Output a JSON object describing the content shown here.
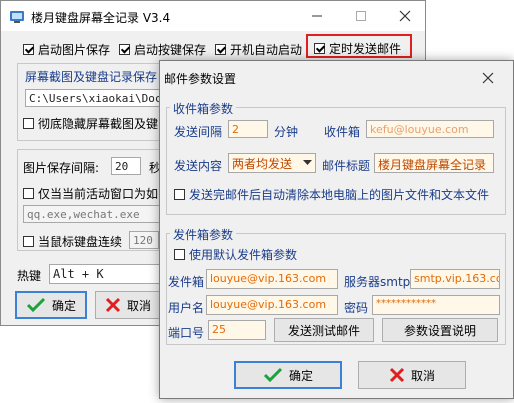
{
  "main": {
    "title": "楼月键盘屏幕全记录 V3.4",
    "opt_save_images": "启动图片保存",
    "opt_save_keys": "启动按键保存",
    "opt_autostart": "开机自动启动",
    "opt_timed_email": "定时发送邮件",
    "screenshot_path_label": "屏幕截图及键盘记录保存",
    "path_value": "C:\\Users\\xiaokai\\Docu",
    "hide_label": "彻底隐藏屏幕截图及键",
    "interval_label": "图片保存间隔:",
    "interval_value": "20",
    "interval_unit": "秒",
    "only_active_label": "仅当当前活动窗口为如",
    "process_list": "qq.exe,wechat.exe",
    "mouse_continuous_label": "当鼠标键盘连续",
    "mouse_continuous_value": "120",
    "hotkey_label": "热键",
    "hotkey_value": "Alt + K",
    "ok_label": "确定",
    "cancel_label": "取消"
  },
  "dialog": {
    "title": "邮件参数设置",
    "recv_group": "收件箱参数",
    "send_interval_label": "发送间隔",
    "send_interval_value": "2",
    "send_interval_unit": "分钟",
    "inbox_label": "收件箱",
    "inbox_value": "kefu@louyue.com",
    "content_label": "发送内容",
    "content_value": "两者均发送",
    "subject_label": "邮件标题",
    "subject_value": "楼月键盘屏幕全记录",
    "clear_label": "发送完邮件后自动清除本地电脑上的图片文件和文本文件",
    "send_group": "发件箱参数",
    "use_default_label": "使用默认发件箱参数",
    "sender_label": "发件箱",
    "sender_value": "louyue@vip.163.com",
    "smtp_label": "服务器smtp",
    "smtp_value": "smtp.vip.163.com",
    "username_label": "用户名",
    "username_value": "louyue@vip.163.com",
    "password_label": "密码",
    "password_value": "************",
    "port_label": "端口号",
    "port_value": "25",
    "test_button": "发送测试邮件",
    "help_button": "参数设置说明",
    "ok_label": "确定",
    "cancel_label": "取消"
  },
  "colors": {
    "red_highlight": "#e02020",
    "field_text_orange": "#e36b0a",
    "check_green": "#1aa33a",
    "cancel_red": "#e02020"
  }
}
